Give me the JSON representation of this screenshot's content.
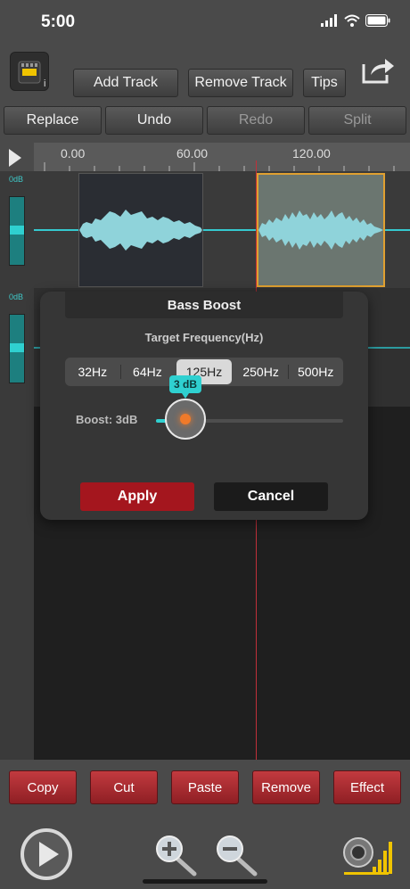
{
  "status": {
    "time": "5:00"
  },
  "toolbar": {
    "add_track": "Add Track",
    "remove_track": "Remove Track",
    "tips": "Tips",
    "replace": "Replace",
    "undo": "Undo",
    "redo": "Redo",
    "split": "Split"
  },
  "timeline": {
    "ticks": [
      "0.00",
      "60.00",
      "120.00"
    ]
  },
  "tracks": [
    {
      "db_label": "0dB"
    },
    {
      "db_label": "0dB"
    }
  ],
  "dialog": {
    "title": "Bass Boost",
    "subtitle": "Target Frequency(Hz)",
    "frequencies": [
      "32Hz",
      "64Hz",
      "125Hz",
      "250Hz",
      "500Hz"
    ],
    "selected_frequency": "125Hz",
    "boost_label": "Boost: 3dB",
    "boost_tooltip": "3 dB",
    "boost_level_fraction": 0.15,
    "apply": "Apply",
    "cancel": "Cancel"
  },
  "bottom": {
    "copy": "Copy",
    "cut": "Cut",
    "paste": "Paste",
    "remove": "Remove",
    "effect": "Effect"
  },
  "colors": {
    "accent": "#2fd0d0",
    "waveform": "#8fd3da",
    "selected_clip_border": "#e0a030",
    "action_red": "#a4161e",
    "playhead": "#c0303a"
  },
  "icons": [
    "wifi-icon",
    "battery-icon",
    "sd-card-icon",
    "share-icon",
    "play-icon",
    "zoom-in-icon",
    "zoom-out-icon",
    "volume-meter-icon"
  ]
}
